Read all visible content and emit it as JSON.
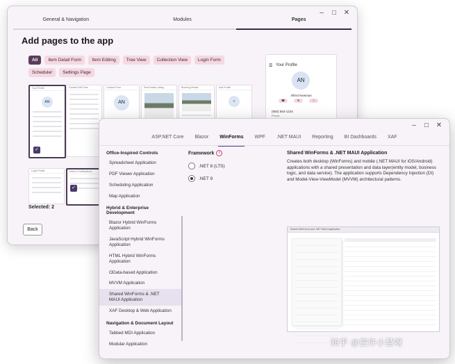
{
  "back_window": {
    "steps": [
      "General & Navigation",
      "Modules",
      "Pages"
    ],
    "active_step": "Pages",
    "title": "Add pages to the app",
    "filters": [
      "All",
      "Item Detail Form",
      "Item Editing",
      "Tree View",
      "Collection View",
      "Login Form",
      "Scheduler",
      "Settings Page"
    ],
    "active_filter": "All",
    "thumb_titles": [
      "Your Profile",
      "Contact Edit Form",
      "Contact Form",
      "Real Estate Listing",
      "Booking Details",
      "Add Profile",
      "Login Profile",
      "Notes & Notifications"
    ],
    "thumb_avatar": "AN",
    "selected_text": "Selected: 2",
    "back_button": "Back",
    "profile": {
      "title": "Your Profile",
      "avatar": "AN",
      "name": "Alfred Newman",
      "phone": "(650) 563-1234",
      "phone_label": "Phone"
    }
  },
  "front_window": {
    "tabs": [
      "ASP.NET Core",
      "Blazor",
      "WinForms",
      "WPF",
      ".NET MAUI",
      "Reporting",
      "BI Dashboards",
      "XAF"
    ],
    "active_tab": "WinForms",
    "categories": [
      {
        "name": "Office-Inspired Controls",
        "items": [
          "Spreadsheet Application",
          "PDF Viewer Application",
          "Scheduling Application",
          "Map Application"
        ]
      },
      {
        "name": "Hybrid & Enterprise Development",
        "items": [
          "Blazor Hybrid WinForms Application",
          "JavaScript Hybrid WinForms Application",
          "HTML Hybrid WinForms Application",
          "OData-based Application",
          "MVVM Application",
          "Shared WinForms & .NET MAUI Application",
          "XAF Desktop & Web Application"
        ]
      },
      {
        "name": "Navigation & Document Layout",
        "items": [
          "Tabbed MDI Application",
          "Modular Application"
        ]
      }
    ],
    "selected_item": "Shared WinForms & .NET MAUI Application",
    "framework": {
      "label": "Framework",
      "options": [
        ".NET 8 (LTS)",
        ".NET 9"
      ],
      "selected": ".NET 9"
    },
    "description": {
      "title": "Shared WinForms & .NET MAUI Application",
      "text": "Creates both desktop (WinForms) and mobile (.NET MAUI for iOS/Android) applications with a shared presentation and data layer(entity model, business logic, and data service). The application supports Dependency Injection (DI) and Model-View-ViewModel (MVVM) architectural patterns."
    },
    "preview_title": "Shared WinForms and .NET MAUI Application"
  },
  "watermark": "知乎 @控件小慧呀",
  "colors": {
    "accent": "#5b3d5a",
    "chip": "#f6d8e2",
    "tab_underline": "#5b3d8a"
  }
}
